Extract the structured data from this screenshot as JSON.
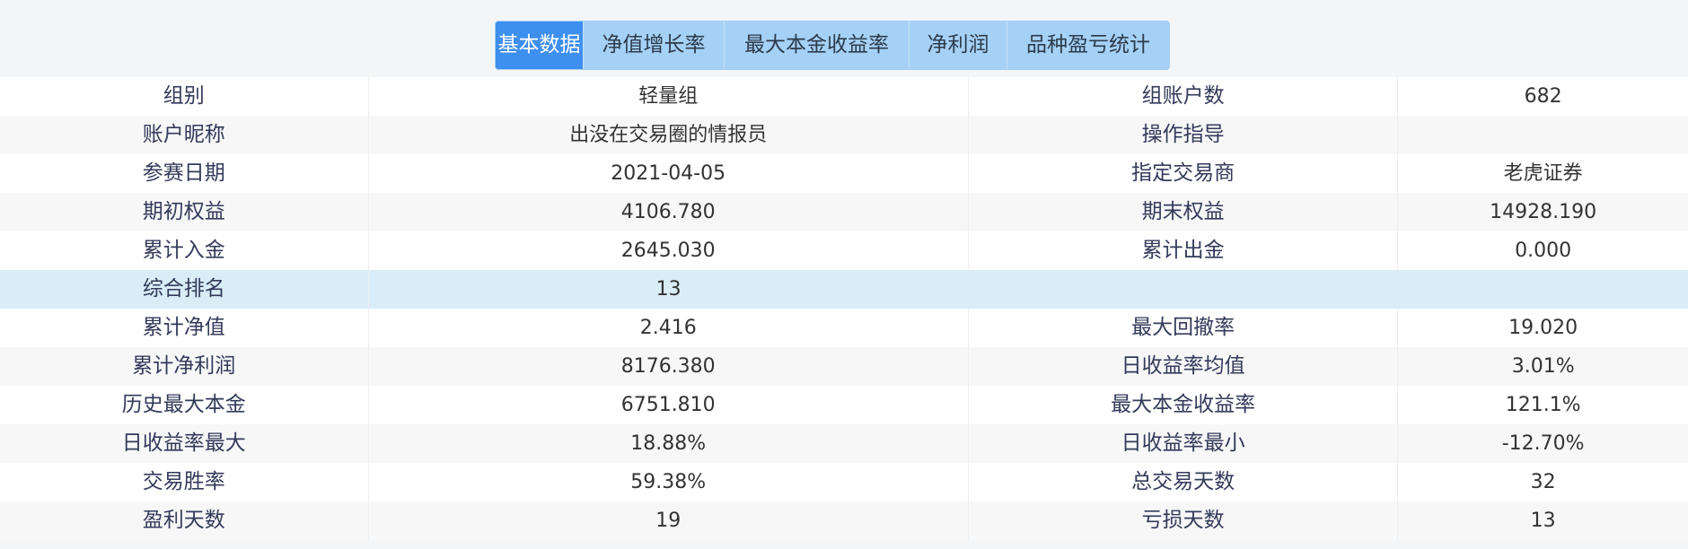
{
  "tabs": [
    {
      "label": "基本数据",
      "active": true
    },
    {
      "label": "净值增长率",
      "active": false
    },
    {
      "label": "最大本金收益率",
      "active": false
    },
    {
      "label": "净利润",
      "active": false
    },
    {
      "label": "品种盈亏统计",
      "active": false
    }
  ],
  "colors": {
    "tab_active_bg": "#3d8ff0",
    "tab_bg": "#a5d1f7",
    "highlight_row_bg": "#d9edf7"
  },
  "rows": [
    {
      "label1": "组别",
      "value1": "轻量组",
      "label2": "组账户数",
      "value2": "682"
    },
    {
      "label1": "账户昵称",
      "value1": "出没在交易圈的情报员",
      "label2": "操作指导",
      "value2": ""
    },
    {
      "label1": "参赛日期",
      "value1": "2021-04-05",
      "label2": "指定交易商",
      "value2": "老虎证券"
    },
    {
      "label1": "期初权益",
      "value1": "4106.780",
      "label2": "期末权益",
      "value2": "14928.190"
    },
    {
      "label1": "累计入金",
      "value1": "2645.030",
      "label2": "累计出金",
      "value2": "0.000"
    },
    {
      "label1": "综合排名",
      "value1": "13"
    },
    {
      "label1": "累计净值",
      "value1": "2.416",
      "label2": "最大回撤率",
      "value2": "19.020"
    },
    {
      "label1": "累计净利润",
      "value1": "8176.380",
      "label2": "日收益率均值",
      "value2": "3.01%"
    },
    {
      "label1": "历史最大本金",
      "value1": "6751.810",
      "label2": "最大本金收益率",
      "value2": "121.1%"
    },
    {
      "label1": "日收益率最大",
      "value1": "18.88%",
      "label2": "日收益率最小",
      "value2": "-12.70%"
    },
    {
      "label1": "交易胜率",
      "value1": "59.38%",
      "label2": "总交易天数",
      "value2": "32"
    },
    {
      "label1": "盈利天数",
      "value1": "19",
      "label2": "亏损天数",
      "value2": "13"
    }
  ]
}
